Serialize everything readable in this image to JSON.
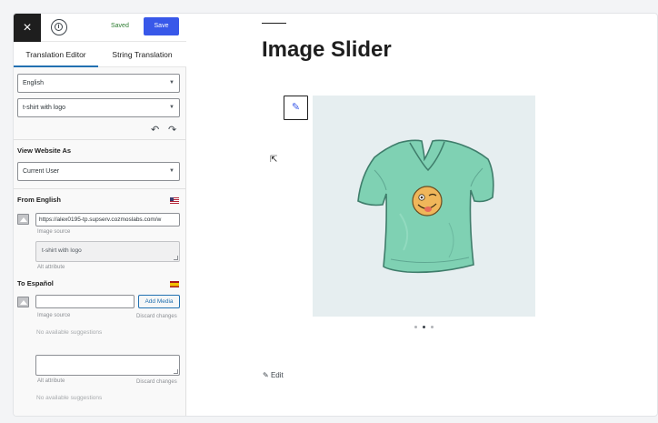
{
  "topbar": {
    "close_icon": "×",
    "info_icon": "i",
    "saved_label": "Saved",
    "save_label": "Save"
  },
  "tabs": [
    {
      "label": "Translation Editor",
      "active": true
    },
    {
      "label": "String Translation",
      "active": false
    }
  ],
  "language_select": {
    "value": "English"
  },
  "string_select": {
    "value": "t-shirt with logo"
  },
  "history": {
    "undo_icon": "↶",
    "redo_icon": "↷"
  },
  "view_as": {
    "title": "View Website As",
    "value": "Current User"
  },
  "source": {
    "title": "From English",
    "image_source_value": "https://alex0195-tp.supserv.cozmoslabs.com/w",
    "image_source_caption": "Image source",
    "alt_value": "t-shirt with logo",
    "alt_caption": "Alt attribute"
  },
  "target": {
    "title": "To Español",
    "image_source_value": "",
    "add_media_label": "Add Media",
    "image_source_caption": "Image source",
    "discard_label_1": "Discard changes",
    "suggestions_1": "No available suggestions",
    "alt_value": "",
    "alt_caption": "Alt attribute",
    "discard_label_2": "Discard changes",
    "suggestions_2": "No available suggestions"
  },
  "main": {
    "title": "Image Slider",
    "pen_icon": "✎",
    "cursor_icon": "⇱",
    "slider_dots": [
      false,
      true,
      false
    ],
    "edit_label": "Edit"
  },
  "colors": {
    "accent": "#3858e9",
    "tab_underline": "#2271b1",
    "saved_text": "#2e7d32",
    "shirt": "#7fd1b3",
    "slide_bg": "#e6eef0"
  }
}
